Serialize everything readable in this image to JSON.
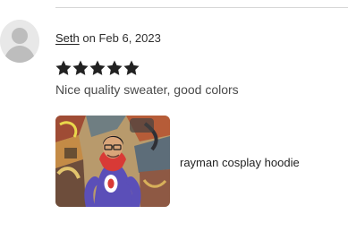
{
  "review": {
    "author": "Seth",
    "date_prefix": "on",
    "date": "Feb 6, 2023",
    "rating": 5,
    "max_rating": 5,
    "text": "Nice quality sweater, good colors",
    "photo_caption": "rayman cosplay hoodie"
  },
  "icons": {
    "avatar": "default-user-avatar-icon",
    "star": "filled-star-icon"
  },
  "colors": {
    "star": "#222222",
    "text": "#4a4a4a",
    "divider": "#d6d6d6",
    "hoodie": "#5b4fb8",
    "hood_lining": "#d83a36"
  }
}
